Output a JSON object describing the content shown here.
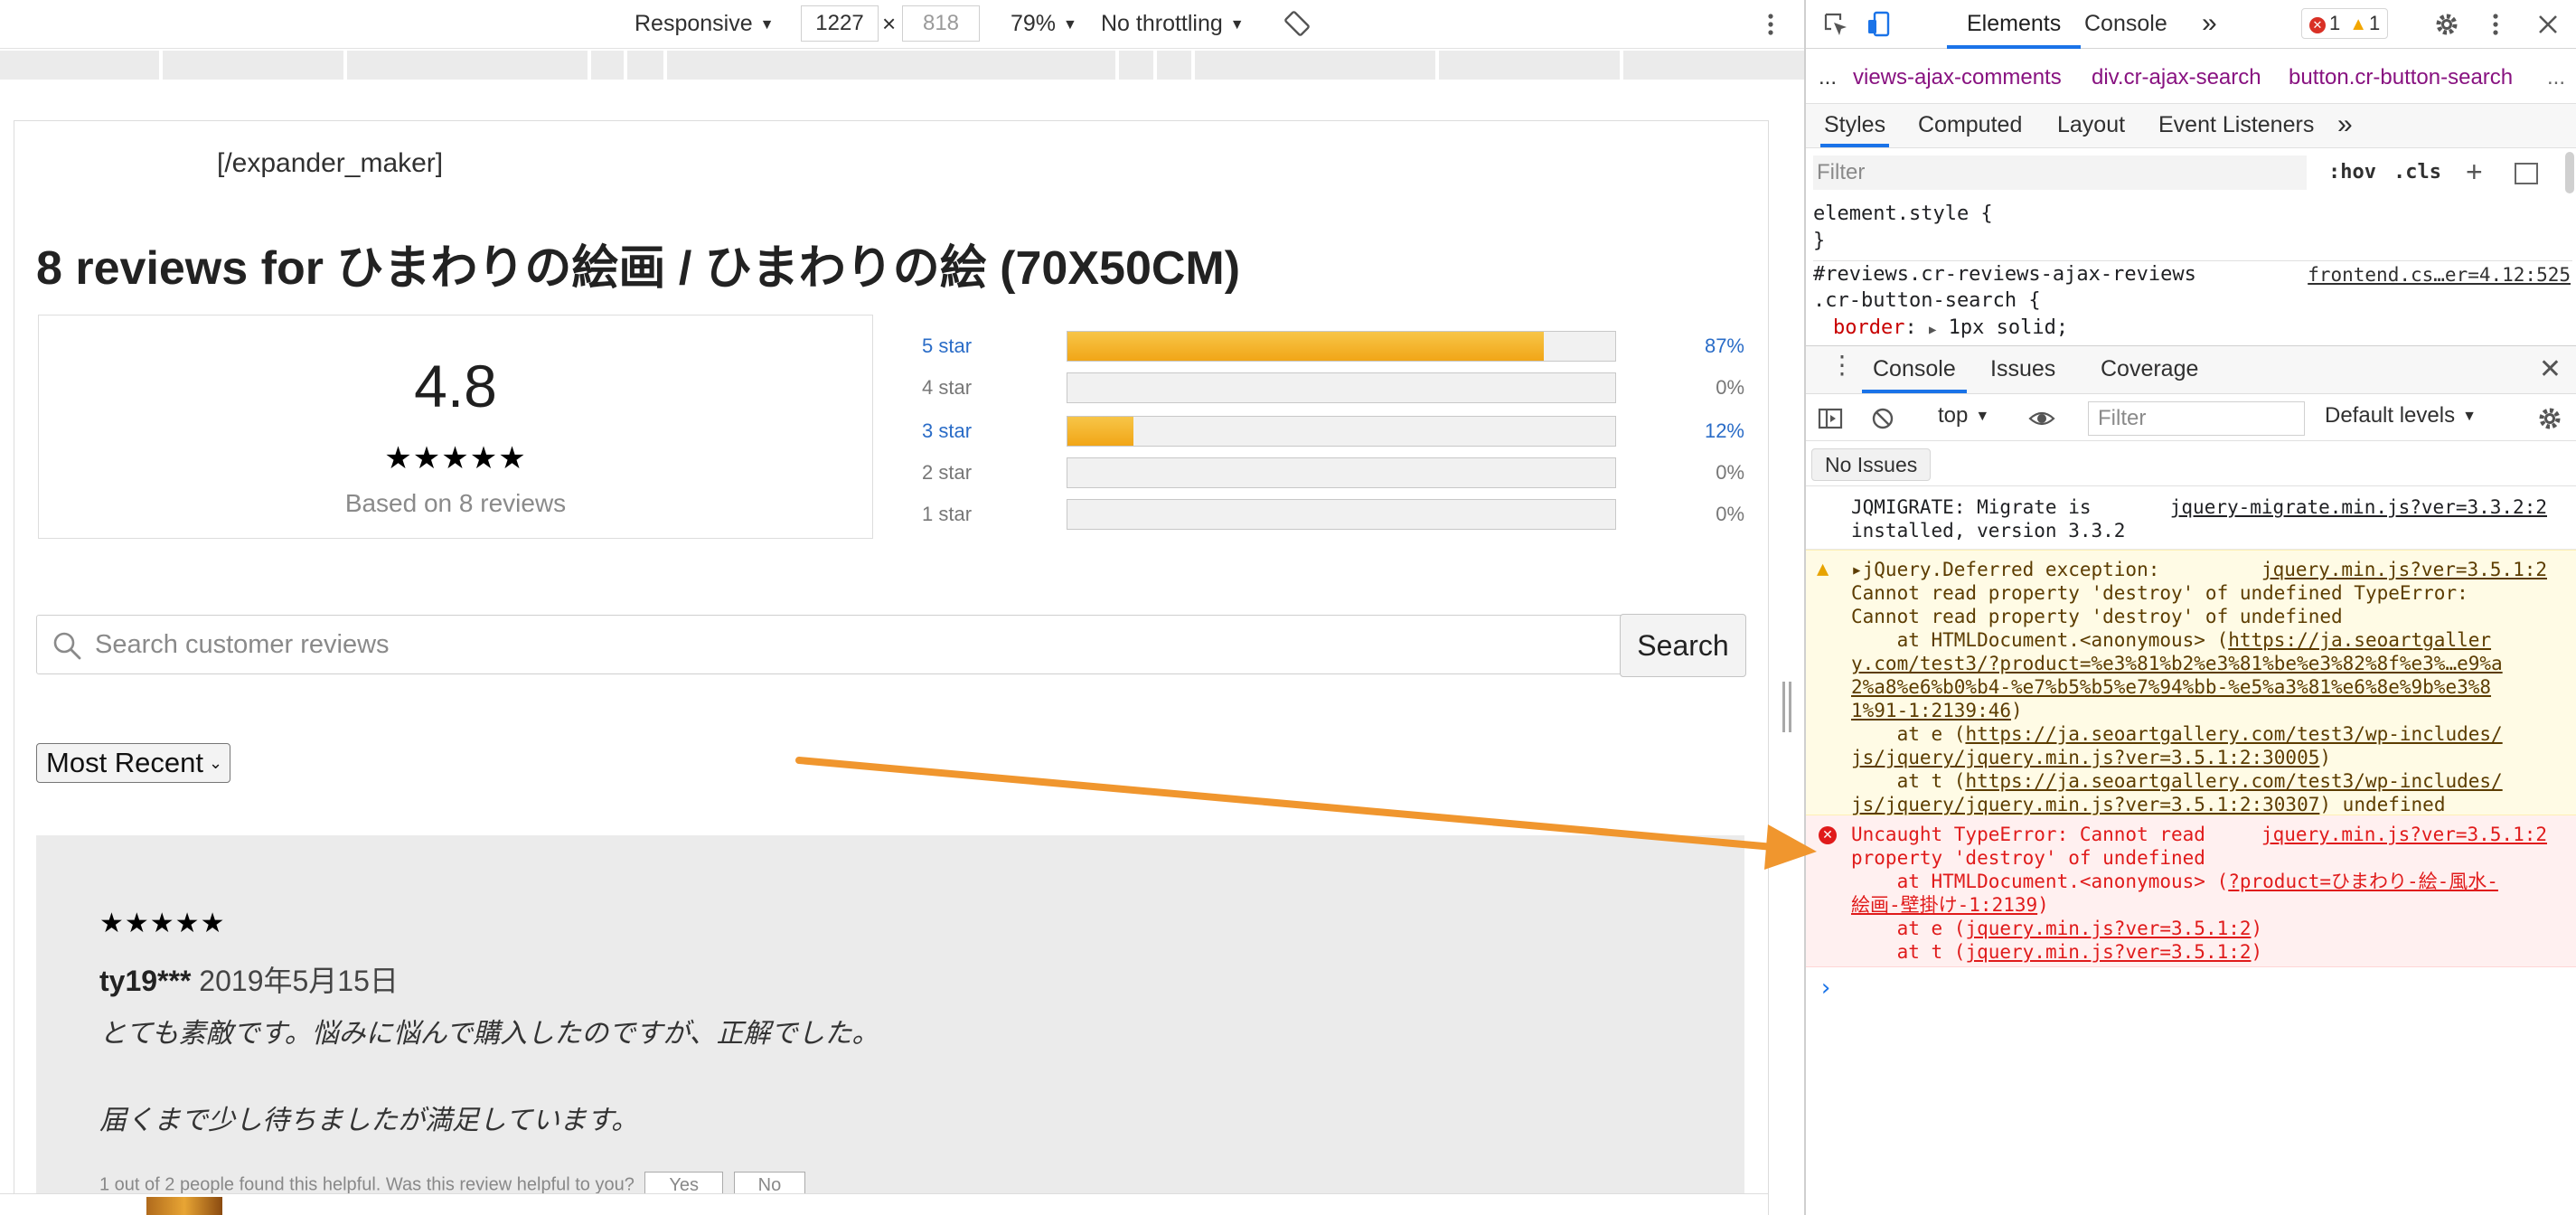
{
  "emulation_toolbar": {
    "device": "Responsive",
    "width": "1227",
    "times": "×",
    "height": "818",
    "zoom": "79%",
    "throttling": "No throttling"
  },
  "page": {
    "expander_text": "[/expander_maker]",
    "reviews_title": "8 reviews for ひまわりの絵画 / ひまわりの絵 (70X50CM)",
    "average_rating": "4.8",
    "average_stars": "★★★★★",
    "based_on": "Based on 8 reviews",
    "histogram": [
      {
        "label": "5 star",
        "pct": "87%",
        "fraction": 0.87,
        "linked": true
      },
      {
        "label": "4 star",
        "pct": "0%",
        "fraction": 0,
        "linked": false
      },
      {
        "label": "3 star",
        "pct": "12%",
        "fraction": 0.12,
        "linked": true
      },
      {
        "label": "2 star",
        "pct": "0%",
        "fraction": 0,
        "linked": false
      },
      {
        "label": "1 star",
        "pct": "0%",
        "fraction": 0,
        "linked": false
      }
    ],
    "search_placeholder": "Search customer reviews",
    "search_button": "Search",
    "sort_selected": "Most Recent",
    "review": {
      "stars": "★★★★★",
      "author": "ty19***",
      "date": "2019年5月15日",
      "body_line1": "とても素敵です。悩みに悩んで購入したのですが、正解でした。",
      "body_line2": "届くまで少し待ちましたが満足しています。",
      "helpful_text": "1 out of 2 people found this helpful. Was this review helpful to you?",
      "yes_label": "Yes",
      "no_label": "No"
    }
  },
  "devtools": {
    "tabs": {
      "elements": "Elements",
      "console": "Console",
      "more": "»"
    },
    "error_count": "1",
    "warning_count": "1",
    "breadcrumb": {
      "dots": "...",
      "item1": "views-ajax-comments",
      "item2": "div.cr-ajax-search",
      "item3": "button.cr-button-search",
      "more": "..."
    },
    "styles_tabs": {
      "styles": "Styles",
      "computed": "Computed",
      "layout": "Layout",
      "listeners": "Event Listeners",
      "more": "»"
    },
    "styles_filter": "Filter",
    "hov": ":hov",
    "cls": ".cls",
    "plus": "+",
    "styles_code": {
      "line1": "element.style {",
      "line2": "}",
      "line3": "#reviews.cr-reviews-ajax-reviews",
      "line4": ".cr-button-search {",
      "prop": "border",
      "value": "1px solid;",
      "source": "frontend.cs…er=4.12:525"
    },
    "drawer_tabs": {
      "console": "Console",
      "issues": "Issues",
      "coverage": "Coverage",
      "close": "✕"
    },
    "console_toolbar": {
      "context": "top",
      "filter": "Filter",
      "levels": "Default levels"
    },
    "no_issues": "No Issues",
    "messages": {
      "log_text": "JQMIGRATE: Migrate is\ninstalled, version 3.3.2",
      "log_src": "jquery-migrate.min.js?ver=3.3.2:2",
      "warn_line1": "▸jQuery.Deferred exception:",
      "warn_src": "jquery.min.js?ver=3.5.1:2",
      "warn_line2": "Cannot read property 'destroy' of undefined TypeError:",
      "warn_line3": "Cannot read property 'destroy' of undefined",
      "warn_line4_pre": "    at HTMLDocument.<anonymous> (",
      "warn_link1a": "https://ja.seoartgaller",
      "warn_link1b": "y.com/test3/?product=%e3%81%b2%e3%81%be%e3%82%8f%e3%…e9%a",
      "warn_link1c": "2%a8%e6%b0%b4-%e7%b5%b5%e7%94%bb-%e5%a3%81%e6%8e%9b%e3%8",
      "warn_link1d": "1%91-1:2139:46",
      "warn_line5_pre": "    at e (",
      "warn_link2a": "https://ja.seoartgallery.com/test3/wp-includes/",
      "warn_link2b": "js/jquery/jquery.min.js?ver=3.5.1:2:30005",
      "warn_line6_pre": "    at t (",
      "warn_link3a": "https://ja.seoartgallery.com/test3/wp-includes/",
      "warn_link3b": "js/jquery/jquery.min.js?ver=3.5.1:2:30307",
      "warn_tail": " undefined",
      "err_line1": "Uncaught TypeError: Cannot read",
      "err_src": "jquery.min.js?ver=3.5.1:2",
      "err_line2": "property 'destroy' of undefined",
      "err_line3_pre": "    at HTMLDocument.<anonymous> (",
      "err_link1a": "?product=ひまわり-絵-風水-",
      "err_link1b": "絵画-壁掛け-1:2139",
      "err_line4_pre": "    at e (",
      "err_link2": "jquery.min.js?ver=3.5.1:2",
      "err_line5_pre": "    at t (",
      "err_link3": "jquery.min.js?ver=3.5.1:2",
      "prompt": "›"
    }
  },
  "colors": {
    "accent_blue": "#1a73e8",
    "annotation_arrow": "#f0962e",
    "histogram_fill": "#f1a617",
    "error_red": "#e01b1b",
    "warning_bg": "#fffbe5",
    "error_bg": "#fff0f0"
  }
}
